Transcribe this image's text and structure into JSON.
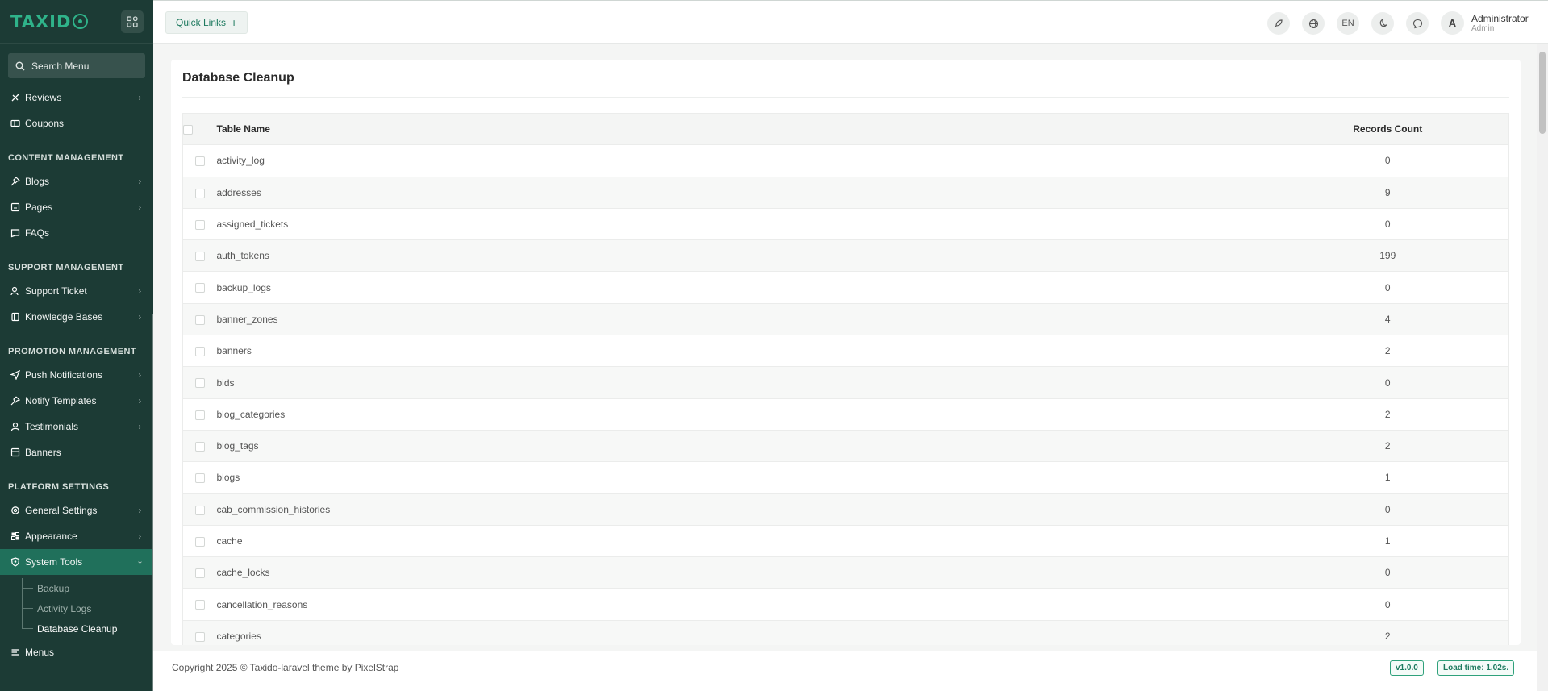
{
  "brand": {
    "logo_text": "TAXID",
    "accent": "#2fb38a"
  },
  "sidebar": {
    "search_placeholder": "Search Menu",
    "items_top": [
      {
        "label": "Reviews",
        "icon": "reviews-icon",
        "expandable": true
      },
      {
        "label": "Coupons",
        "icon": "coupon-icon",
        "expandable": false
      }
    ],
    "sections": [
      {
        "title": "CONTENT MANAGEMENT",
        "items": [
          {
            "label": "Blogs",
            "icon": "pin-icon",
            "expandable": true
          },
          {
            "label": "Pages",
            "icon": "pages-icon",
            "expandable": true
          },
          {
            "label": "FAQs",
            "icon": "faq-icon",
            "expandable": false
          }
        ]
      },
      {
        "title": "SUPPORT MANAGEMENT",
        "items": [
          {
            "label": "Support Ticket",
            "icon": "support-icon",
            "expandable": true
          },
          {
            "label": "Knowledge Bases",
            "icon": "book-icon",
            "expandable": true
          }
        ]
      },
      {
        "title": "PROMOTION MANAGEMENT",
        "items": [
          {
            "label": "Push Notifications",
            "icon": "send-icon",
            "expandable": true
          },
          {
            "label": "Notify Templates",
            "icon": "pin-icon",
            "expandable": true
          },
          {
            "label": "Testimonials",
            "icon": "user-icon",
            "expandable": true
          },
          {
            "label": "Banners",
            "icon": "banner-icon",
            "expandable": false
          }
        ]
      },
      {
        "title": "PLATFORM SETTINGS",
        "items": [
          {
            "label": "General Settings",
            "icon": "gear-icon",
            "expandable": true
          },
          {
            "label": "Appearance",
            "icon": "palette-icon",
            "expandable": true
          },
          {
            "label": "System Tools",
            "icon": "shield-icon",
            "expandable": true,
            "active": true
          }
        ]
      }
    ],
    "system_tools_sub": [
      "Backup",
      "Activity Logs",
      "Database Cleanup"
    ],
    "bottom_item": {
      "label": "Menus",
      "icon": "menu-icon"
    }
  },
  "header": {
    "quick_links": "Quick Links",
    "lang": "EN",
    "user_initial": "A",
    "user_name": "Administrator",
    "user_role": "Admin"
  },
  "page": {
    "title": "Database Cleanup",
    "columns": [
      "Table Name",
      "Records Count"
    ],
    "rows": [
      {
        "name": "activity_log",
        "count": "0"
      },
      {
        "name": "addresses",
        "count": "9"
      },
      {
        "name": "assigned_tickets",
        "count": "0"
      },
      {
        "name": "auth_tokens",
        "count": "199"
      },
      {
        "name": "backup_logs",
        "count": "0"
      },
      {
        "name": "banner_zones",
        "count": "4"
      },
      {
        "name": "banners",
        "count": "2"
      },
      {
        "name": "bids",
        "count": "0"
      },
      {
        "name": "blog_categories",
        "count": "2"
      },
      {
        "name": "blog_tags",
        "count": "2"
      },
      {
        "name": "blogs",
        "count": "1"
      },
      {
        "name": "cab_commission_histories",
        "count": "0"
      },
      {
        "name": "cache",
        "count": "1"
      },
      {
        "name": "cache_locks",
        "count": "0"
      },
      {
        "name": "cancellation_reasons",
        "count": "0"
      },
      {
        "name": "categories",
        "count": "2"
      }
    ]
  },
  "footer": {
    "copyright": "Copyright 2025 © Taxido-laravel theme by PixelStrap",
    "version": "v1.0.0",
    "load_time": "Load time: 1.02s."
  }
}
